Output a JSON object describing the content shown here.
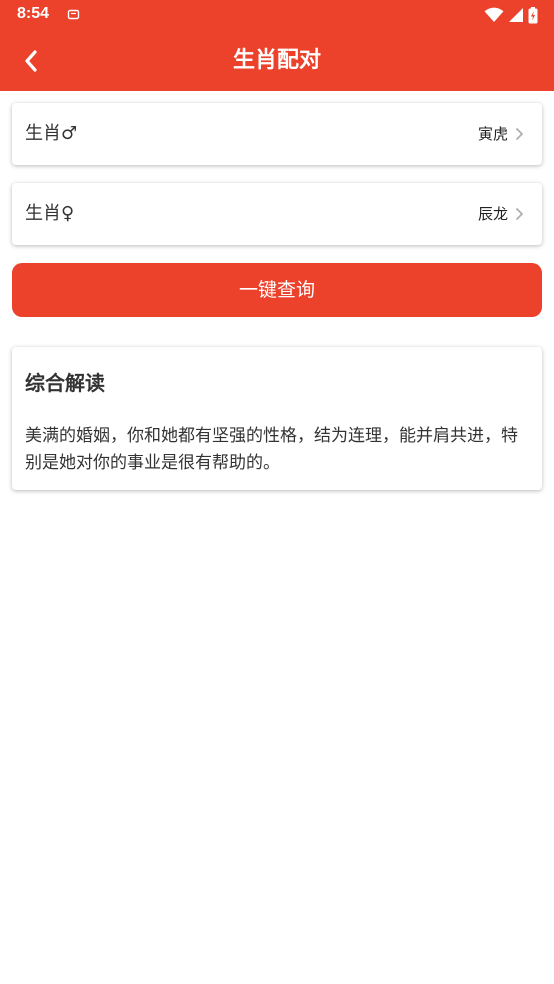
{
  "status_bar": {
    "time": "8:54",
    "icons": [
      "notification-icon",
      "wifi-icon",
      "signal-icon",
      "battery-icon"
    ]
  },
  "toolbar": {
    "title": "生肖配对",
    "back_icon": "back-arrow-icon"
  },
  "selectors": [
    {
      "label": "生肖♂",
      "value": "寅虎"
    },
    {
      "label": "生肖♀",
      "value": "辰龙"
    }
  ],
  "query_button": {
    "label": "一键查询"
  },
  "result": {
    "title": "综合解读",
    "text": "美满的婚姻，你和她都有坚强的性格，结为连理，能并肩共进，特别是她对你的事业是很有帮助的。"
  },
  "colors": {
    "primary": "#ec412b",
    "text": "#333333",
    "background": "#ffffff"
  }
}
